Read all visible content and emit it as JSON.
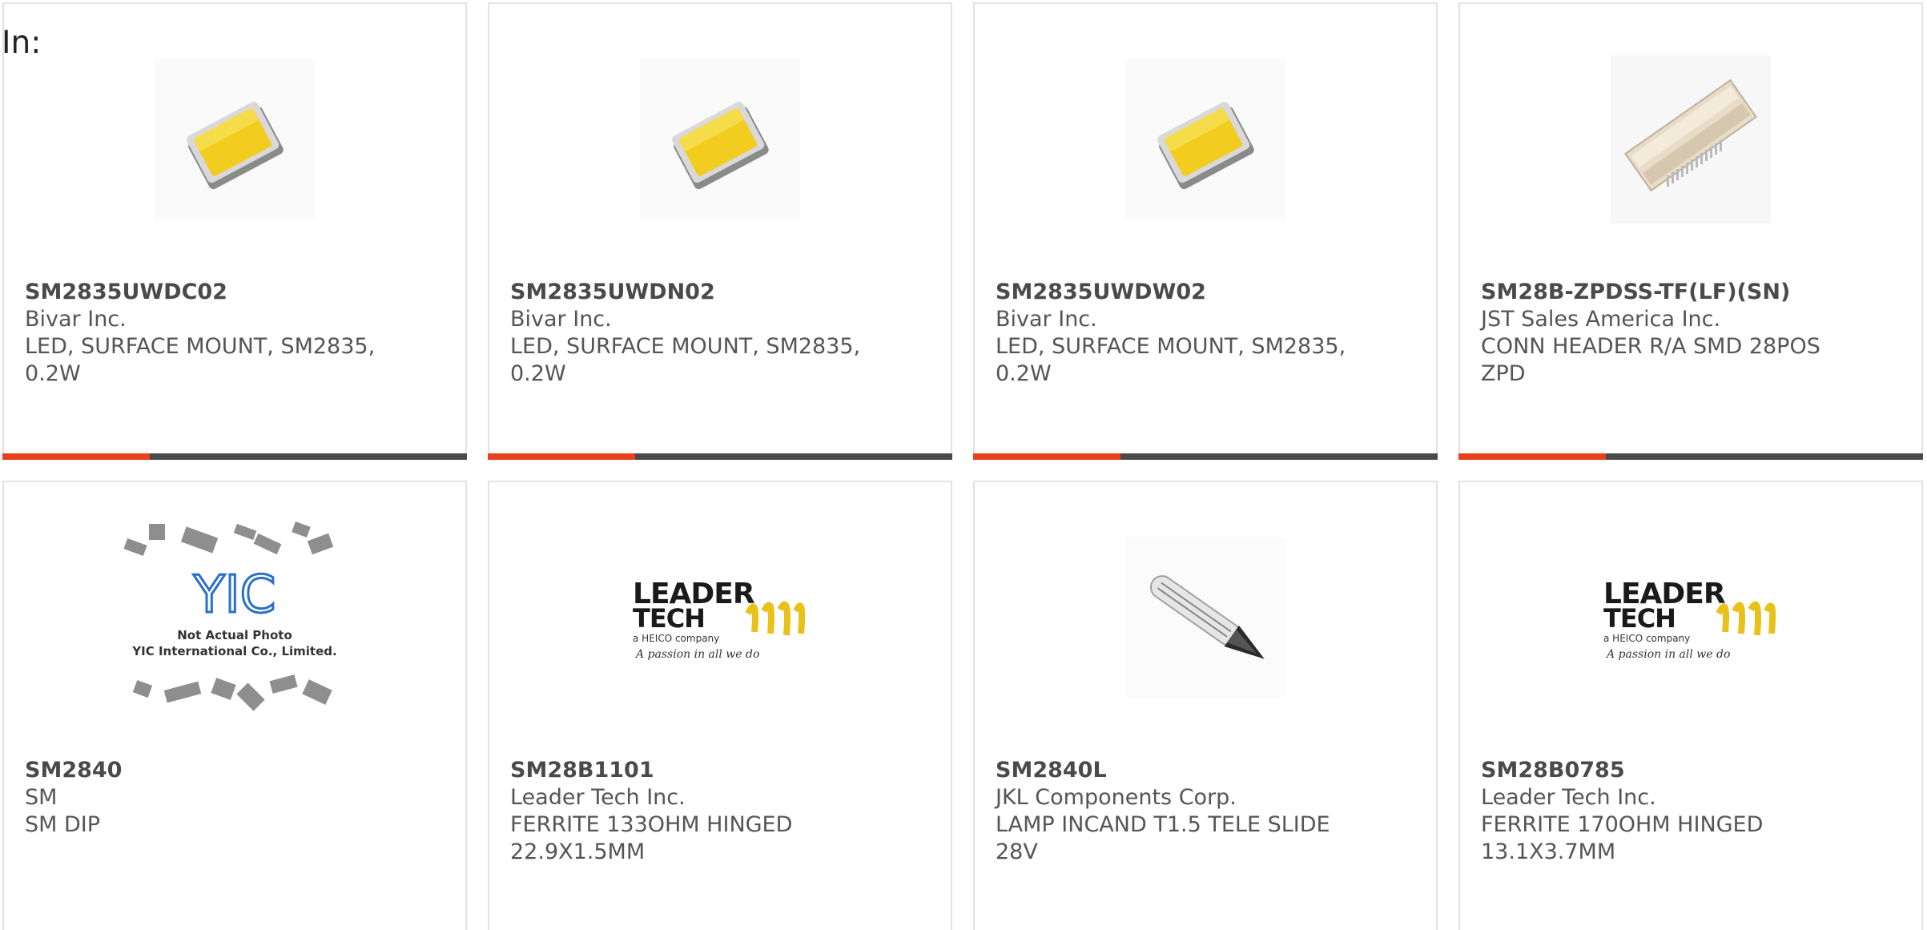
{
  "header": {
    "label": "In:"
  },
  "colors": {
    "accent": "#e8401c",
    "bar": "#4a4a4a"
  },
  "products": [
    {
      "part": "SM2835UWDC02",
      "manufacturer": "Bivar Inc.",
      "description": "LED, SURFACE MOUNT, SM2835, 0.2W",
      "image": "led-smd-icon"
    },
    {
      "part": "SM2835UWDN02",
      "manufacturer": "Bivar Inc.",
      "description": "LED, SURFACE MOUNT, SM2835, 0.2W",
      "image": "led-smd-icon"
    },
    {
      "part": "SM2835UWDW02",
      "manufacturer": "Bivar Inc.",
      "description": "LED, SURFACE MOUNT, SM2835, 0.2W",
      "image": "led-smd-icon"
    },
    {
      "part": "SM28B-ZPDSS-TF(LF)(SN)",
      "manufacturer": "JST Sales America Inc.",
      "description": "CONN HEADER R/A SMD 28POS ZPD",
      "image": "connector-header-icon"
    },
    {
      "part": "SM2840",
      "manufacturer": "SM",
      "description": "SM DIP",
      "image": "yic-placeholder-image",
      "image_text": {
        "logo": "YIC",
        "line1": "Not Actual Photo",
        "line2": "YIC International Co., Limited."
      }
    },
    {
      "part": "SM28B1101",
      "manufacturer": "Leader Tech Inc.",
      "description": "FERRITE 133OHM HINGED 22.9X1.5MM",
      "image": "leader-tech-logo",
      "image_text": {
        "line1": "LEADER",
        "line2": "TECH",
        "tag": "a HEICO company",
        "slogan": "A passion in all we do"
      }
    },
    {
      "part": "SM2840L",
      "manufacturer": "JKL Components Corp.",
      "description": "LAMP INCAND T1.5 TELE SLIDE 28V",
      "image": "incandescent-lamp-icon"
    },
    {
      "part": "SM28B0785",
      "manufacturer": "Leader Tech Inc.",
      "description": "FERRITE 170OHM HINGED 13.1X3.7MM",
      "image": "leader-tech-logo",
      "image_text": {
        "line1": "LEADER",
        "line2": "TECH",
        "tag": "a HEICO company",
        "slogan": "A passion in all we do"
      }
    }
  ]
}
